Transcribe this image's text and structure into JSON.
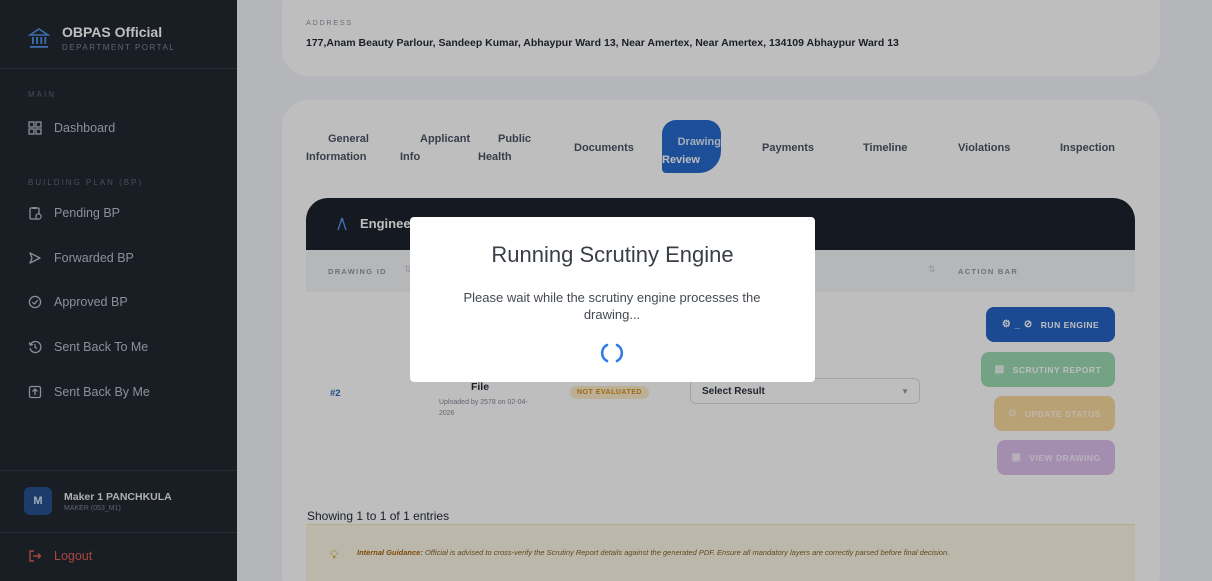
{
  "brand": {
    "title": "OBPAS Official",
    "subtitle": "DEPARTMENT PORTAL"
  },
  "sidebar": {
    "section_main": "MAIN",
    "dashboard": "Dashboard",
    "section_bp": "BUILDING PLAN (BP)",
    "items": [
      {
        "label": "Pending BP",
        "icon": "clipboard-clock-icon"
      },
      {
        "label": "Forwarded BP",
        "icon": "send-icon"
      },
      {
        "label": "Approved BP",
        "icon": "check-circle-icon"
      },
      {
        "label": "Sent Back To Me",
        "icon": "history-icon"
      },
      {
        "label": "Sent Back By Me",
        "icon": "arrow-box-icon"
      }
    ],
    "user": {
      "initial": "M",
      "name": "Maker 1 PANCHKULA",
      "role": "MAKER (053_M1)"
    },
    "logout": "Logout"
  },
  "address": {
    "label": "ADDRESS",
    "value": "177,Anam Beauty Parlour, Sandeep Kumar, Abhaypur Ward 13, Near Amertex, Near Amertex, 134109 Abhaypur Ward 13"
  },
  "tabs": {
    "general": [
      "General",
      "Information"
    ],
    "applicant": [
      "Applicant",
      "Info"
    ],
    "public": [
      "Public",
      "Health"
    ],
    "documents": "Documents",
    "drawing": [
      "Drawing",
      "Review"
    ],
    "payments": "Payments",
    "timeline": "Timeline",
    "violations": "Violations",
    "inspection": "Inspection"
  },
  "engineering": {
    "title": "Enginee",
    "columns": {
      "drawing_id": "DRAWING ID",
      "action_bar": "ACTION BAR"
    }
  },
  "row": {
    "id": "#2",
    "file": "File",
    "uploaded": "Uploaded by 2578 on 02-04-2026",
    "status": "NOT EVALUATED",
    "select_value": "Select Result"
  },
  "actions": {
    "run": "RUN ENGINE",
    "report": "SCRUTINY REPORT",
    "update": "UPDATE STATUS",
    "view": "VIEW DRAWING"
  },
  "showing": "Showing 1 to 1 of 1 entries",
  "guidance": {
    "label": "Internal Guidance:",
    "text": "Official is advised to cross-verify the Scrutiny Report details against the generated PDF. Ensure all mandatory layers are correctly parsed before final decision."
  },
  "modal": {
    "title": "Running Scrutiny Engine",
    "message": "Please wait while the scrutiny engine processes the drawing..."
  },
  "colors": {
    "accent": "#1f66c9",
    "sidebar": "#1b2129",
    "logout": "#e25a4f"
  }
}
